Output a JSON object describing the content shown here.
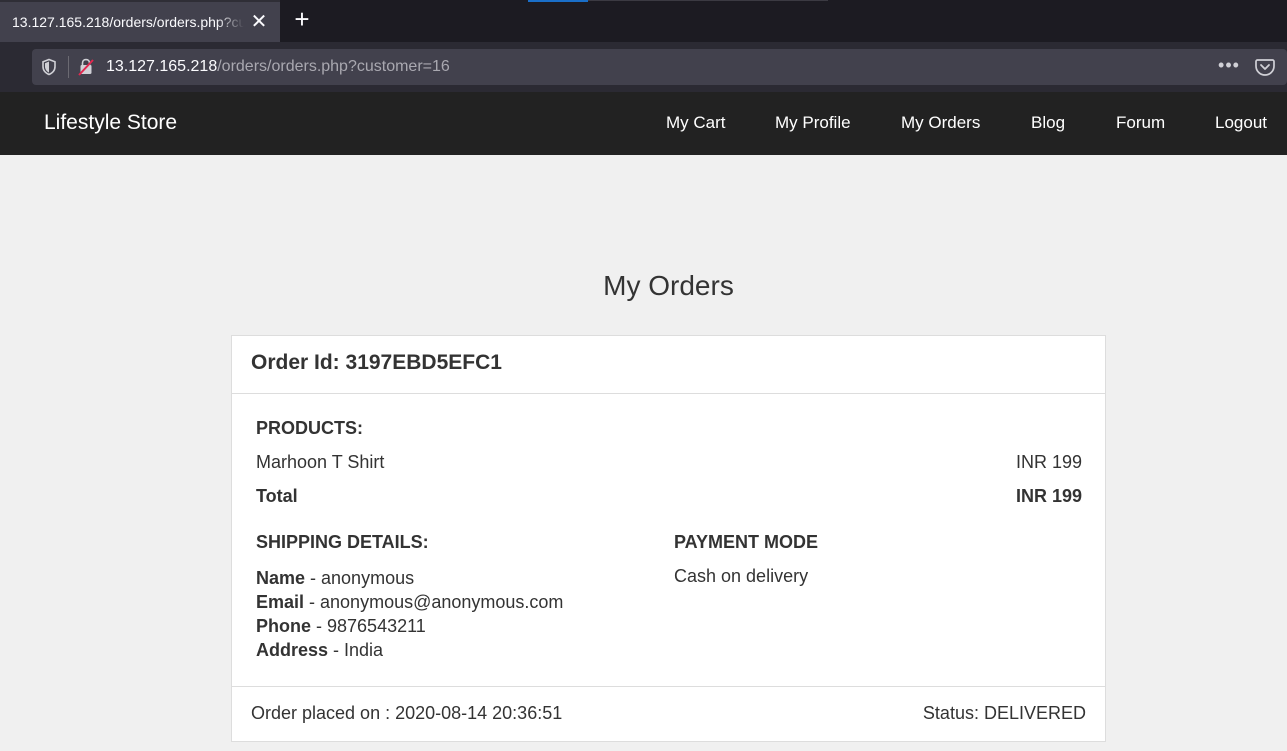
{
  "browser": {
    "tab_title": "13.127.165.218/orders/orders.php?customer=16",
    "close_glyph": "✕",
    "new_tab_glyph": "+",
    "url_host": "13.127.165.218",
    "url_path": "/orders/orders.php?customer=16",
    "more_glyph": "•••",
    "icons": [
      "shield-icon",
      "insecure-lock-icon",
      "more-icon",
      "pocket-icon"
    ]
  },
  "site": {
    "brand": "Lifestyle Store",
    "nav": [
      "My Cart",
      "My Profile",
      "My Orders",
      "Blog",
      "Forum",
      "Logout"
    ]
  },
  "page": {
    "title": "My Orders"
  },
  "order": {
    "id_label": "Order Id: 3197EBD5EFC1",
    "products_label": "PRODUCTS:",
    "products": [
      {
        "name": "Marhoon T Shirt",
        "price": "INR 199"
      }
    ],
    "total_label": "Total",
    "total_value": "INR 199",
    "shipping_label": "SHIPPING DETAILS:",
    "shipping": {
      "name_label": "Name",
      "name": " - anonymous",
      "email_label": "Email",
      "email": " - anonymous@anonymous.com",
      "phone_label": "Phone",
      "phone": " - 9876543211",
      "address_label": "Address",
      "address": " - India"
    },
    "payment_label": "PAYMENT MODE",
    "payment_value": "Cash on delivery",
    "placed_on": "Order placed on : 2020-08-14 20:36:51",
    "status": "Status: DELIVERED"
  },
  "colors": {
    "site_header": "#222222",
    "page_bg": "#f0f0f0",
    "browser_tabbar": "#1c1b22",
    "browser_toolbar": "#2b2a33"
  }
}
